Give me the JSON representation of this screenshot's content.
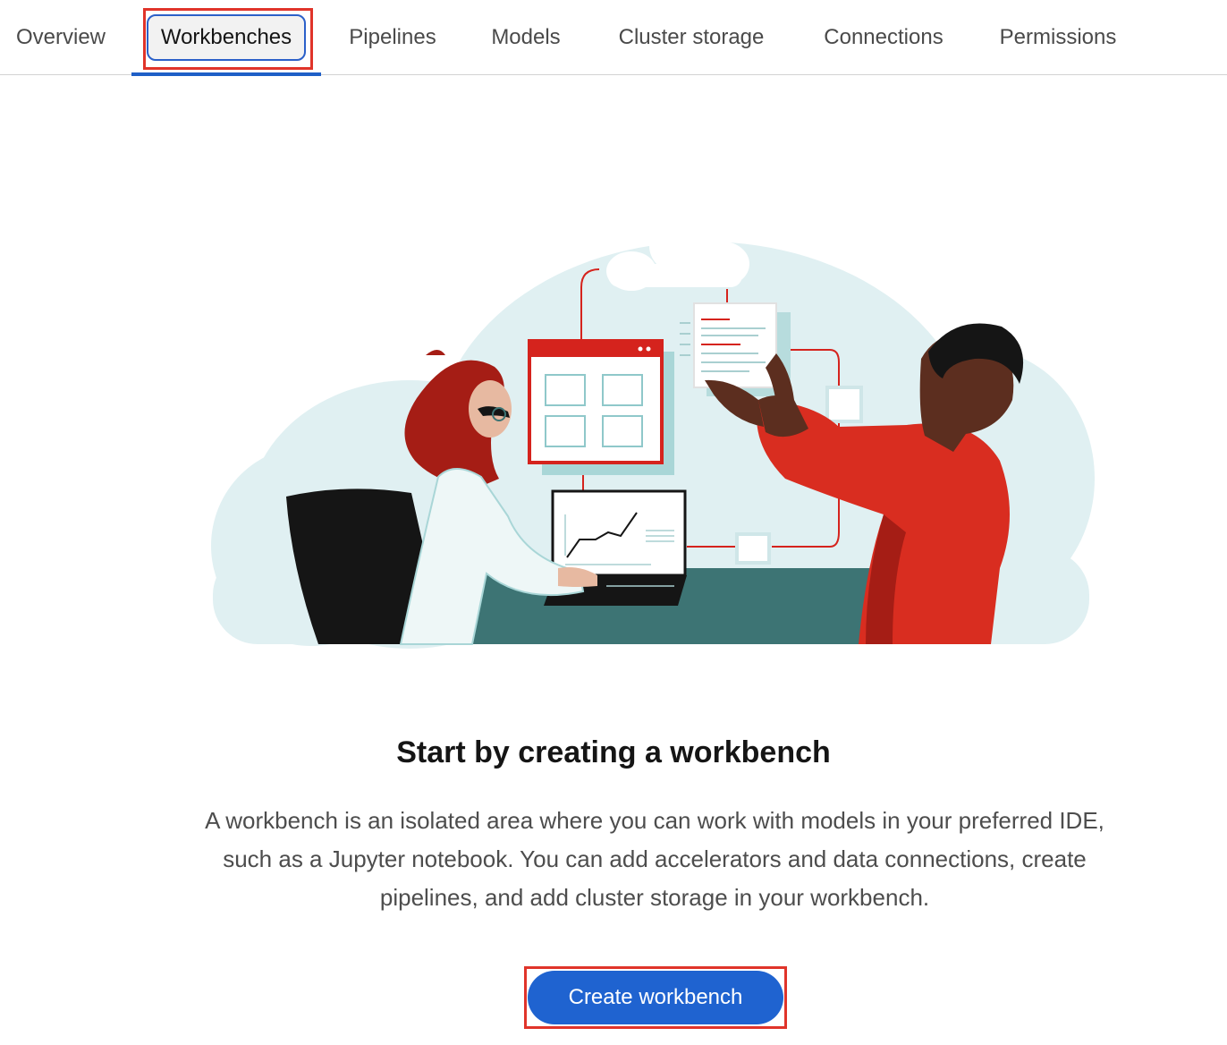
{
  "tabs": [
    {
      "label": "Overview",
      "active": false
    },
    {
      "label": "Workbenches",
      "active": true
    },
    {
      "label": "Pipelines",
      "active": false
    },
    {
      "label": "Models",
      "active": false
    },
    {
      "label": "Cluster storage",
      "active": false
    },
    {
      "label": "Connections",
      "active": false
    },
    {
      "label": "Permissions",
      "active": false
    }
  ],
  "empty_state": {
    "title": "Start by creating a workbench",
    "description": "A workbench is an isolated area where you can work with models in your preferred IDE, such as a Jupyter notebook. You can add accelerators and data connections, create pipelines, and add cluster storage in your workbench.",
    "button_label": "Create workbench",
    "illustration": "people-collaborating-illustration"
  },
  "colors": {
    "accent_blue": "#1f63d0",
    "highlight_red": "#e0342a",
    "brand_red": "#ee0000"
  }
}
